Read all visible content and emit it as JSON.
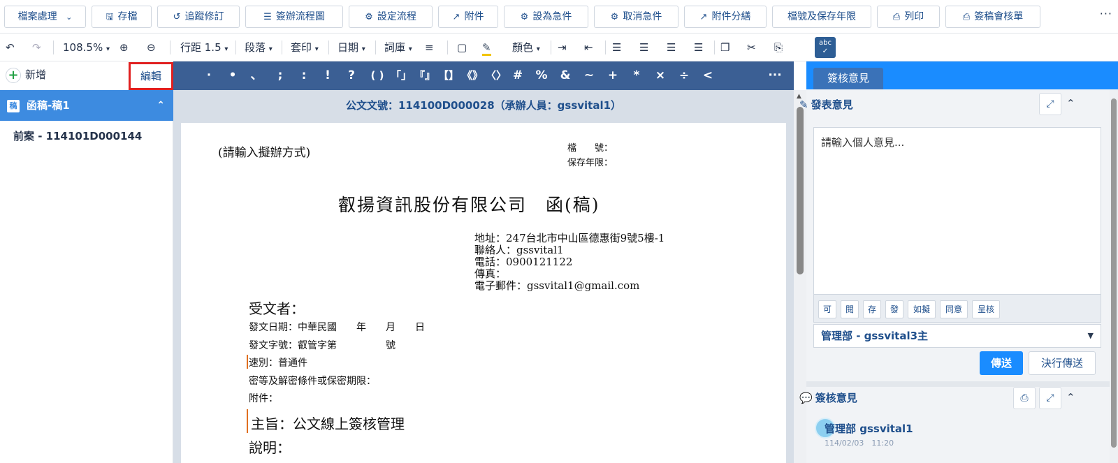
{
  "topbar": {
    "buttons": [
      {
        "label": "檔案處理",
        "icon": "chevron-down-icon"
      },
      {
        "label": "存檔",
        "icon": "save-icon"
      },
      {
        "label": "追蹤修訂",
        "icon": "history-icon"
      },
      {
        "label": "簽辦流程圖",
        "icon": "sitemap-icon"
      },
      {
        "label": "設定流程",
        "icon": "gears-icon"
      },
      {
        "label": "附件",
        "icon": "paperclip-icon"
      },
      {
        "label": "設為急件",
        "icon": "gears-icon"
      },
      {
        "label": "取消急件",
        "icon": "gears-icon"
      },
      {
        "label": "附件分繕",
        "icon": "paperclip-icon"
      },
      {
        "label": "檔號及保存年限",
        "icon": ""
      },
      {
        "label": "列印",
        "icon": "print-icon"
      },
      {
        "label": "簽稿會核單",
        "icon": "print-icon"
      }
    ],
    "more": "···"
  },
  "toolbar": {
    "zoom": "108.5%",
    "line_spacing": "行距 1.5",
    "paragraph": "段落",
    "mail_merge": "套印",
    "date": "日期",
    "phrase_bank": "詞庫",
    "color": "顏色",
    "spellcheck": "abc"
  },
  "left": {
    "add_label": "新增",
    "edit_label": "編輯",
    "doc_item": "函稿-稿1",
    "doc_icon_char": "稿",
    "prior_case": "前案 - 114101D000144"
  },
  "symbols": [
    "·",
    "•",
    "、",
    ";",
    ":",
    "!",
    "?",
    "( )",
    "「」",
    "『』",
    "【】",
    "《》",
    "〈〉",
    "#",
    "%",
    "&",
    "~",
    "+",
    "*",
    "×",
    "÷",
    "<",
    "···"
  ],
  "document": {
    "header": "公文文號：114100D000028（承辦人員：gssvital1）",
    "method_placeholder": "(請輸入擬辦方式)",
    "file_no_label": "檔　　號：",
    "retention_label": "保存年限：",
    "title": "叡揚資訊股份有限公司　函(稿)",
    "address": "地址：247台北市中山區德惠街9號5樓-1",
    "contact": "聯絡人：gssvital1",
    "phone": "電話：0900121122",
    "fax": "傳真：",
    "email": "電子郵件：gssvital1@gmail.com",
    "recipient": "受文者：",
    "issue_date": "發文日期：中華民國　　年　　月　　日",
    "issue_no": "發文字號：叡管字第　　　　　號",
    "speed": "速別：普通件",
    "secrecy": "密等及解密條件或保密期限：",
    "attachment": "附件：",
    "subject": "主旨：公文線上簽核管理",
    "explanation": "說明："
  },
  "right": {
    "tab": "簽核意見",
    "post_opinion": "發表意見",
    "placeholder": "請輸入個人意見...",
    "quick_buttons": [
      "可",
      "閱",
      "存",
      "發",
      "如擬",
      "同意",
      "呈核"
    ],
    "selected_user": "管理部 - gssvital3主",
    "send": "傳送",
    "send_final": "決行傳送",
    "opinions_title": "簽核意見",
    "entry_user": "管理部 gssvital1",
    "entry_time": "114/02/03　11:20"
  }
}
